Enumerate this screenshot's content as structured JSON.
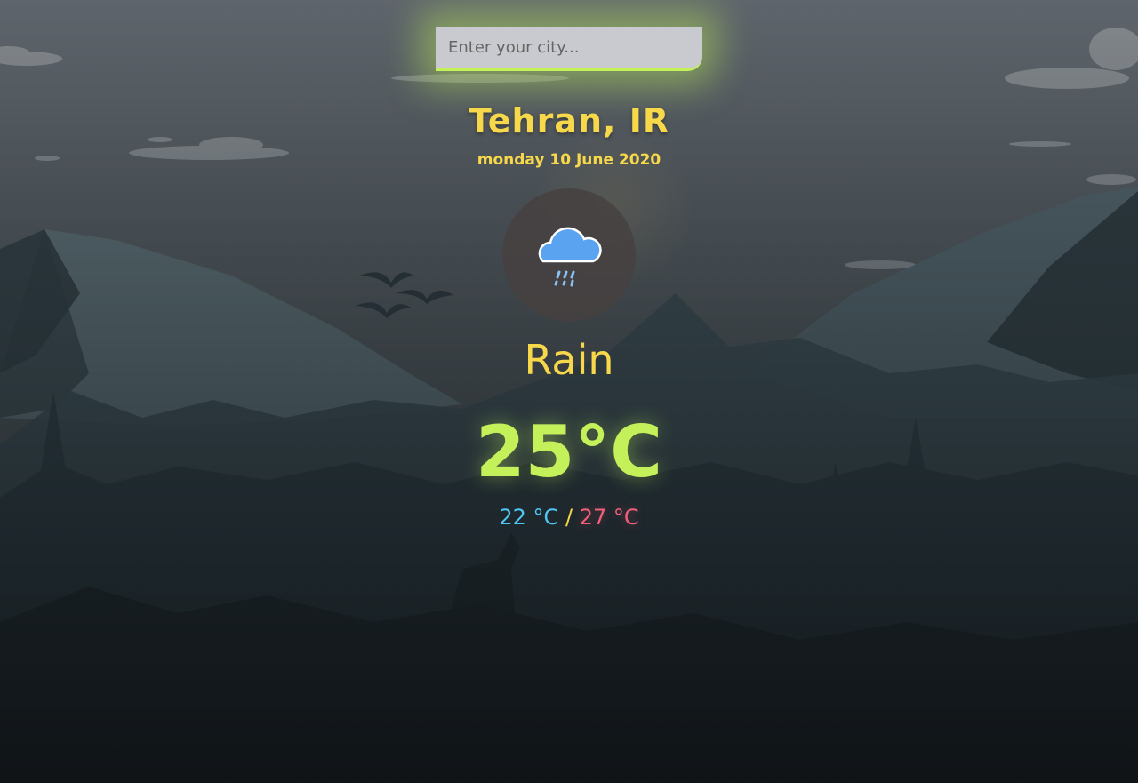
{
  "search": {
    "placeholder": "Enter your city..."
  },
  "location": {
    "name": "Tehran, IR",
    "date": "monday 10 June 2020"
  },
  "weather": {
    "icon": "rain-cloud-icon",
    "condition": "Rain",
    "temperature": "25°C",
    "min": "22 °C",
    "separator": "/",
    "max": "27 °C"
  },
  "colors": {
    "accent_yellow": "#f7d84a",
    "accent_green": "#c4f05a",
    "min_blue": "#4fc6f5",
    "max_red": "#f25f7a",
    "cloud_blue": "#5aa3f0"
  }
}
